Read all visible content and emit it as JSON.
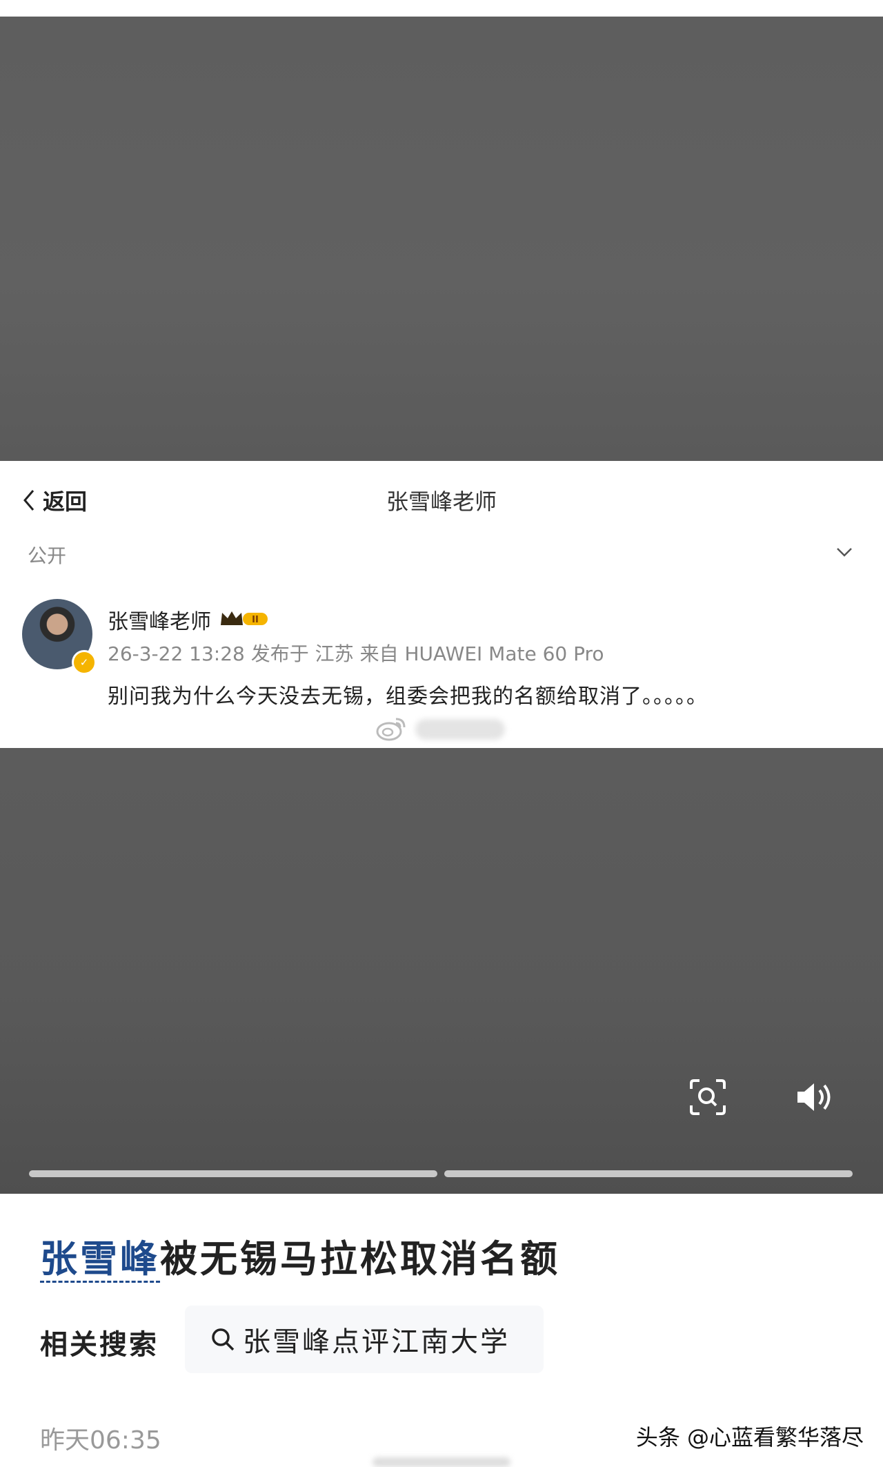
{
  "nav": {
    "back_label": "返回",
    "title": "张雪峰老师"
  },
  "post": {
    "privacy": "公开",
    "username": "张雪峰老师",
    "meta": "26-3-22 13:28 发布于 江苏 来自 HUAWEI Mate 60 Pro",
    "text": "别问我为什么今天没去无锡，组委会把我的名额给取消了。。。。。",
    "icons": {
      "back": "chevron-left-icon",
      "dropdown": "chevron-down-icon",
      "vip": "crown-badge-icon",
      "weibo": "weibo-logo-icon",
      "scan": "scan-search-icon",
      "volume": "volume-icon"
    }
  },
  "article": {
    "headline_name": "张雪峰",
    "headline_rest": "被无锡马拉松取消名额",
    "related_label": "相关搜索",
    "related_query": "张雪峰点评江南大学",
    "timestamp": "昨天06:35",
    "watermark": "头条 @心蓝看繁华落尽"
  },
  "colors": {
    "accent_blue": "#1e4a8c",
    "video_bg": "#5e5e5e",
    "vip_gold": "#f5b400"
  }
}
